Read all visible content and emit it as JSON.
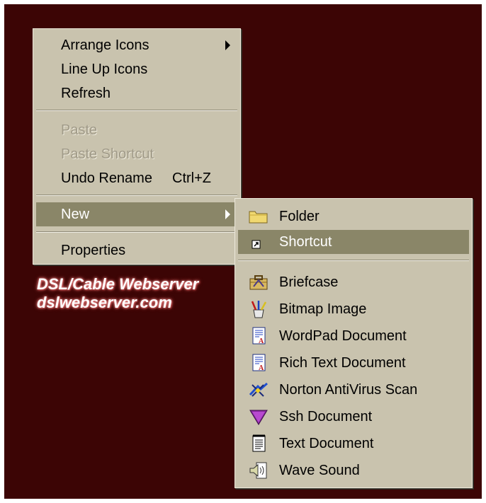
{
  "context_menu": {
    "items": [
      {
        "label": "Arrange Icons",
        "has_submenu": true
      },
      {
        "label": "Line Up Icons"
      },
      {
        "label": "Refresh"
      },
      {
        "label": "Paste",
        "disabled": true
      },
      {
        "label": "Paste Shortcut",
        "disabled": true
      },
      {
        "label": "Undo Rename",
        "shortcut": "Ctrl+Z"
      },
      {
        "label": "New",
        "has_submenu": true,
        "highlighted": true
      },
      {
        "label": "Properties"
      }
    ]
  },
  "new_submenu": {
    "items": [
      {
        "label": "Folder",
        "icon": "folder-icon"
      },
      {
        "label": "Shortcut",
        "icon": "shortcut-icon",
        "highlighted": true
      },
      {
        "label": "Briefcase",
        "icon": "briefcase-icon"
      },
      {
        "label": "Bitmap Image",
        "icon": "paint-brush-icon"
      },
      {
        "label": "WordPad Document",
        "icon": "wordpad-icon"
      },
      {
        "label": "Rich Text Document",
        "icon": "rich-text-icon"
      },
      {
        "label": "Norton AntiVirus Scan",
        "icon": "norton-antivirus-icon"
      },
      {
        "label": "Ssh Document",
        "icon": "ssh-icon"
      },
      {
        "label": "Text Document",
        "icon": "notepad-icon"
      },
      {
        "label": "Wave Sound",
        "icon": "speaker-icon"
      }
    ]
  },
  "watermark": {
    "line1": "DSL/Cable Webserver",
    "line2": "dslwebserver.com"
  },
  "colors": {
    "desktop": "#3c0505",
    "menu_face": "#c9c3ae",
    "highlight": "#8a8668",
    "disabled_text": "#a09a88"
  }
}
